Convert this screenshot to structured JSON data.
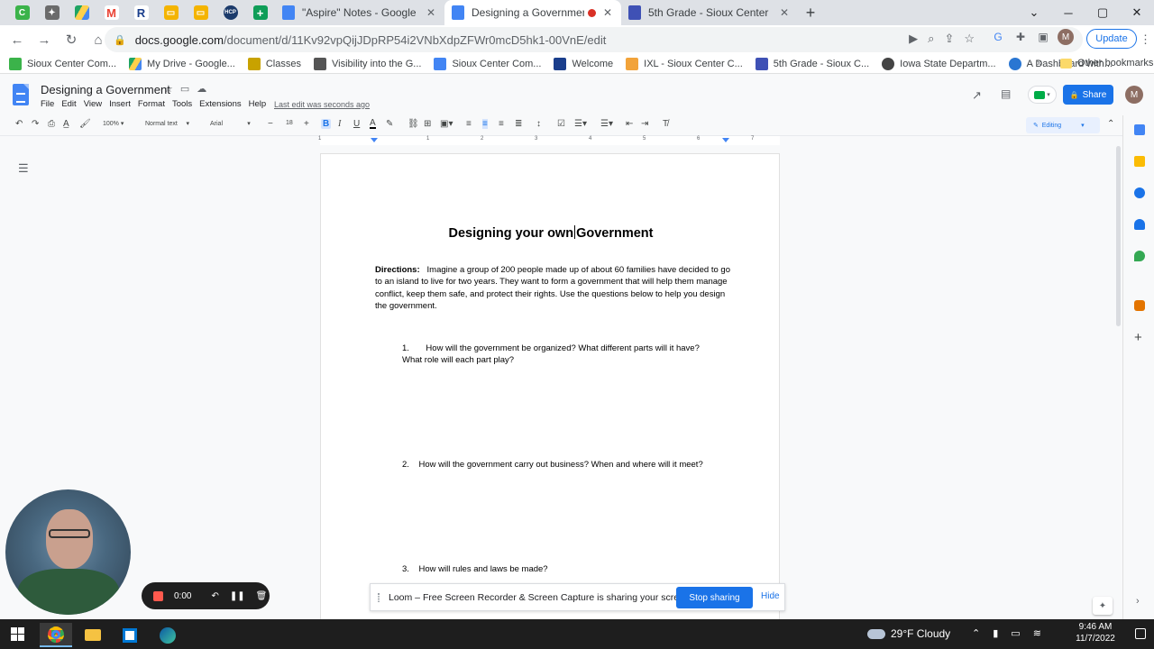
{
  "browser": {
    "tabs": [
      {
        "title": "\"Aspire\" Notes - Google Docs",
        "active": false
      },
      {
        "title": "Designing a Government - G",
        "active": true
      },
      {
        "title": "5th Grade - Sioux Center",
        "active": false
      }
    ],
    "url_host": "docs.google.com",
    "url_path": "/document/d/11Kv92vpQijJDpRP54i2VNbXdpZFWr0mcD5hk1-00VnE/edit",
    "update_label": "Update",
    "profile_initial": "M"
  },
  "bookmarks": {
    "items": [
      "Sioux Center Com...",
      "My Drive - Google...",
      "Classes",
      "Visibility into the G...",
      "Sioux Center Com...",
      "Welcome",
      "IXL - Sioux Center C...",
      "5th Grade - Sioux C...",
      "Iowa State Departm...",
      "A Dashboard with..."
    ],
    "more": "»",
    "other": "Other bookmarks"
  },
  "docs": {
    "title": "Designing a Government",
    "menu": [
      "File",
      "Edit",
      "View",
      "Insert",
      "Format",
      "Tools",
      "Extensions",
      "Help"
    ],
    "last_edit": "Last edit was seconds ago",
    "share_label": "Share",
    "account_initial": "M",
    "toolbar": {
      "zoom": "100%",
      "style": "Normal text",
      "font": "Arial",
      "size": "18",
      "mode": "Editing"
    },
    "ruler_numbers": [
      "1",
      "1",
      "2",
      "3",
      "4",
      "5",
      "6",
      "7"
    ]
  },
  "document": {
    "heading_before_caret": "Designing your own",
    "heading_after_caret": "Government",
    "directions_label": "Directions:",
    "directions_text": "Imagine a group of 200 people made up of about 60 families have decided to go to an island to live for two years. They want to form a government that will help them manage conflict, keep them safe, and protect their rights. Use the questions below to help you design the government.",
    "questions": [
      {
        "num": "1.",
        "text": "How will the government be organized? What different parts will it have?",
        "text2": "What role will each part play?"
      },
      {
        "num": "2.",
        "text": "How will the government carry out business? When and where will it meet?"
      },
      {
        "num": "3.",
        "text": "How will rules and laws be made?"
      }
    ]
  },
  "loom": {
    "timer": "0:00",
    "banner_text": "Loom – Free Screen Recorder & Screen Capture is sharing your screen.",
    "stop_label": "Stop sharing",
    "hide_label": "Hide"
  },
  "taskbar": {
    "weather": "29°F  Cloudy",
    "time": "9:46 AM",
    "date": "11/7/2022"
  },
  "colors": {
    "accent": "#1a73e8",
    "docs_blue": "#4285f4",
    "record_red": "#ff5a4e"
  }
}
